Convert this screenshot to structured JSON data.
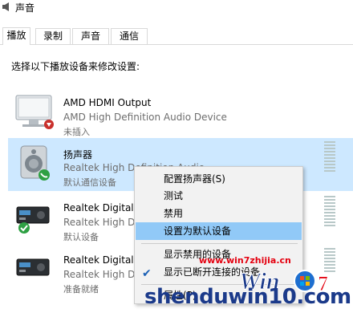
{
  "window": {
    "title": "声音"
  },
  "tabs": [
    {
      "label": "播放",
      "active": true
    },
    {
      "label": "录制",
      "active": false
    },
    {
      "label": "声音",
      "active": false
    },
    {
      "label": "通信",
      "active": false
    }
  ],
  "instruction": "选择以下播放设备来修改设置:",
  "devices": [
    {
      "name": "AMD HDMI Output",
      "driver": "AMD High Definition Audio Device",
      "status": "未插入",
      "icon": "monitor-icon",
      "badge": "unplugged-badge"
    },
    {
      "name": "扬声器",
      "driver": "Realtek High Definition Audio",
      "status": "默认通信设备",
      "icon": "speaker-icon",
      "badge": "phone-badge",
      "selected": true
    },
    {
      "name": "Realtek Digital",
      "driver": "Realtek High D",
      "status": "默认设备",
      "icon": "digital-receiver-icon",
      "badge": "check-badge"
    },
    {
      "name": "Realtek Digital",
      "driver": "Realtek High D",
      "status": "准备就绪",
      "icon": "digital-receiver-icon"
    }
  ],
  "context_menu": {
    "items": [
      {
        "label": "配置扬声器(S)"
      },
      {
        "label": "测试"
      },
      {
        "label": "禁用"
      },
      {
        "label": "设置为默认设备",
        "highlighted": true
      },
      {
        "label": "显示禁用的设备"
      },
      {
        "label": "显示已断开连接的设备",
        "checked": true
      },
      {
        "label": "属性(P)"
      }
    ]
  },
  "watermark": {
    "url": "www.win7zhijia.cn",
    "site": "shenduwin10.com",
    "logo_text": "Win7"
  },
  "colors": {
    "selection": "#cde8ff",
    "menu_highlight": "#91c9f7",
    "check_green": "#2ea043",
    "watermark_red": "#e4000f"
  }
}
